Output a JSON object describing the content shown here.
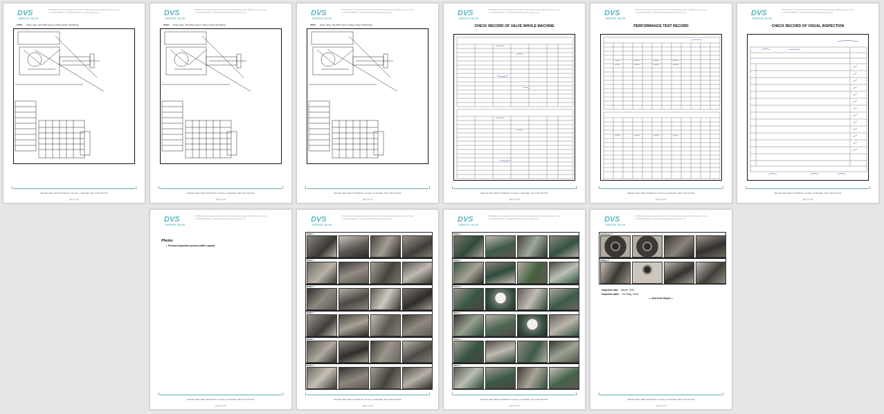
{
  "brand": {
    "name": "DVS",
    "subname": "DERVOS VALVE",
    "color": "#5bb6bf"
  },
  "header": {
    "address": "DVS Building & International Finance Plaza, No.596 Qiaoqu Road, 361008, Xiamen, China",
    "contact": "T: +86-592-5185156   F: +86-592-5185159   www.dervosvalve.com"
  },
  "footer_text": "REFUSE, HELP, BEST PATTERN BY CULLING, FLOWLINES, AND TYPE OPTIONS",
  "pages": [
    {
      "id": "p7",
      "page_label": "Page 7 of 16",
      "drawing_tag": "ITP02",
      "drawing_title": "Globe Valve, DN 1500 Cast Iron Body (Class 150 Rating)"
    },
    {
      "id": "p8",
      "page_label": "Page 8 of 16",
      "drawing_tag": "ITP03",
      "drawing_title": "Globe Valve, DN 1500 Cast Iron Body (Class 150 Rating)"
    },
    {
      "id": "p9",
      "page_label": "Page 9 of 16",
      "drawing_tag": "ITP04",
      "drawing_title": "Globe Valve, DN 1500 Cast Iron Body (Class 150 Rating)"
    },
    {
      "id": "p10",
      "page_label": "Page 10 of 16",
      "section_title": "CHECK RECORD OF VALVE WHOLE MACHINE"
    },
    {
      "id": "p11",
      "page_label": "Page 11 of 16",
      "section_title": "PERFORMANCE TEST RECORD"
    },
    {
      "id": "p12",
      "page_label": "Page 12 of 16",
      "section_title": "CHECK RECORD OF VISUAL INSPECTION"
    },
    {
      "id": "p13",
      "page_label": "Page 13 of 16",
      "photos_heading": "Photos",
      "photos_bullet": "Product Inspection process (with Legend)"
    },
    {
      "id": "p14",
      "page_label": "Page 14 of 16",
      "photo_rows": [
        "ITP02 ▼",
        "ITP03 ▼",
        "ITP04 ▼",
        "ITP05 ▼",
        "ITP06 ▼",
        "ITP07 ▼"
      ]
    },
    {
      "id": "p15",
      "page_label": "Page 15 of 16",
      "photo_rows": [
        "ITP08 ▼",
        "ITP09 ▼",
        "ITP10 ▼",
        "ITP11 ▼",
        "ITP12 ▼",
        "ITP13 ▼"
      ]
    },
    {
      "id": "p16",
      "page_label": "Page 16 of 16",
      "photo_rows": [
        "Handwheel ▼",
        "Bolting ▼"
      ],
      "inspection_date_label": "Inspection date:",
      "inspection_date_value": "Xiamen, 2022",
      "inspection_place_label": "Inspection place:",
      "inspection_place_value": "Zhu Jiang, China",
      "end_text": "----End of the Report----"
    }
  ],
  "colors": {
    "accent": "#5bb6bf",
    "page_bg": "#ffffff",
    "canvas_bg": "#e6e6e6"
  }
}
